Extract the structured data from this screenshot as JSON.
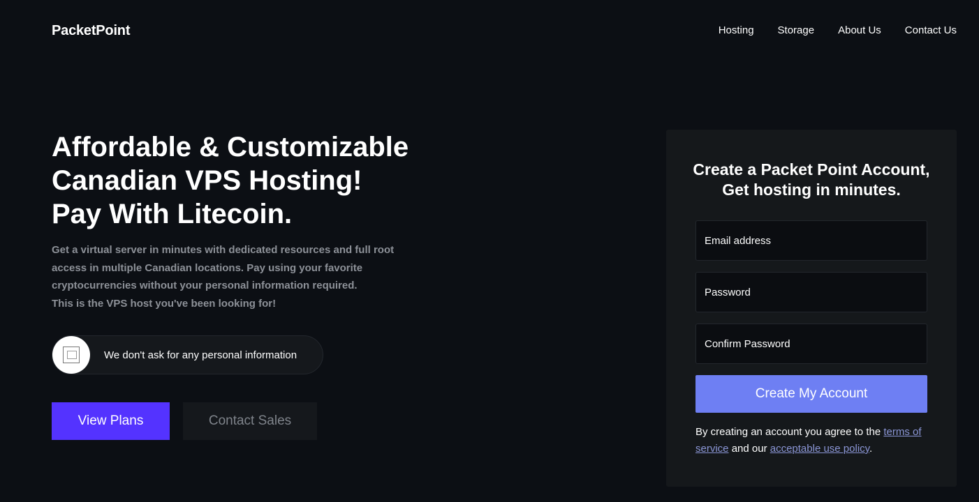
{
  "header": {
    "brand": "PacketPoint",
    "nav": [
      "Hosting",
      "Storage",
      "About Us",
      "Contact Us"
    ]
  },
  "hero": {
    "title_lines": [
      "Affordable & Customizable",
      "Canadian VPS Hosting!",
      "Pay With Litecoin."
    ],
    "description_lines": [
      "Get a virtual server in minutes with dedicated resources and full root",
      "access in multiple Canadian locations. Pay using your favorite",
      "cryptocurrencies without your personal information required.",
      "This is the VPS host you've been looking for!"
    ],
    "pill_text": "We don't ask for any personal information",
    "pill_icon": "broken-image-icon",
    "primary_button": "View Plans",
    "secondary_button": "Contact Sales"
  },
  "signup": {
    "title_lines": [
      "Create a Packet Point Account,",
      "Get hosting in minutes."
    ],
    "email_placeholder": "Email address",
    "password_placeholder": "Password",
    "confirm_placeholder": "Confirm Password",
    "submit_label": "Create My Account",
    "terms_prefix": "By creating an account you agree to the",
    "terms_link": "terms of service",
    "terms_middle": "and our",
    "aup_link": "acceptable use policy",
    "terms_suffix": "."
  },
  "colors": {
    "background": "#0c0f14",
    "card": "#15181b",
    "primary": "#5433ff",
    "create_button": "#6e7ff3",
    "link": "#8b96d6",
    "muted_text": "#8d9198"
  }
}
